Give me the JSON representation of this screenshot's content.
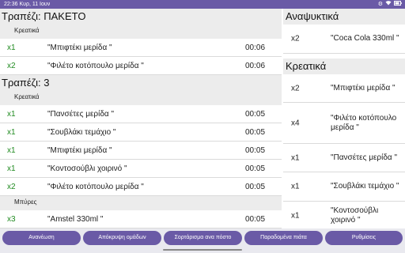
{
  "status_bar": {
    "time": "22:36 Κυρ, 11 Ιουν",
    "icons": [
      "settings-icon",
      "wifi-icon",
      "battery-icon"
    ]
  },
  "left_panel": {
    "tables": [
      {
        "title": "Τραπέζι: ΠΑΚΕΤΟ",
        "categories": [
          {
            "name": "Κρεατικά",
            "items": [
              {
                "qty": "x1",
                "name": "\"Μπιφτέκι μερίδα \"",
                "time": "00:06"
              },
              {
                "qty": "x2",
                "name": "\"Φιλέτο κοτόπουλο μερίδα \"",
                "time": "00:06"
              }
            ]
          }
        ]
      },
      {
        "title": "Τραπέζι: 3",
        "categories": [
          {
            "name": "Κρεατικά",
            "items": [
              {
                "qty": "x1",
                "name": "\"Πανσέτες μερίδα \"",
                "time": "00:05"
              },
              {
                "qty": "x1",
                "name": "\"Σουβλάκι τεμάχιο \"",
                "time": "00:05"
              },
              {
                "qty": "x1",
                "name": "\"Μπιφτέκι μερίδα \"",
                "time": "00:05"
              },
              {
                "qty": "x1",
                "name": "\"Κοντοσούβλι χοιρινό \"",
                "time": "00:05"
              },
              {
                "qty": "x2",
                "name": "\"Φιλέτο κοτόπουλο μερίδα \"",
                "time": "00:05"
              }
            ]
          },
          {
            "name": "Μπύρες",
            "items": [
              {
                "qty": "x3",
                "name": "\"Amstel 330ml \"",
                "time": "00:05"
              }
            ]
          }
        ]
      }
    ]
  },
  "right_panel": {
    "sections": [
      {
        "title": "Αναψυκτικά",
        "items": [
          {
            "qty": "x2",
            "name": "\"Coca Cola 330ml \""
          }
        ]
      },
      {
        "title": "Κρεατικά",
        "items": [
          {
            "qty": "x2",
            "name": "\"Μπιφτέκι μερίδα \""
          },
          {
            "qty": "x4",
            "name": "\"Φιλέτο κοτόπουλο μερίδα \""
          },
          {
            "qty": "x1",
            "name": "\"Πανσέτες μερίδα \""
          },
          {
            "qty": "x1",
            "name": "\"Σουβλάκι τεμάχιο \""
          },
          {
            "qty": "x1",
            "name": "\"Κοντοσούβλι χοιρινό \""
          }
        ]
      }
    ]
  },
  "bottom_bar": {
    "refresh": "Ανανέωση",
    "hide_groups": "Απόκρυψη ομάδων",
    "sort_by_table": "Σορτάρισμα ανα πόστο",
    "delivered_plates": "Παραδομένα πιάτα",
    "settings": "Ρυθμίσεις"
  },
  "colors": {
    "accent": "#6a5aa6",
    "qty_green": "#1f8a1f",
    "section_bg": "#ececec"
  }
}
